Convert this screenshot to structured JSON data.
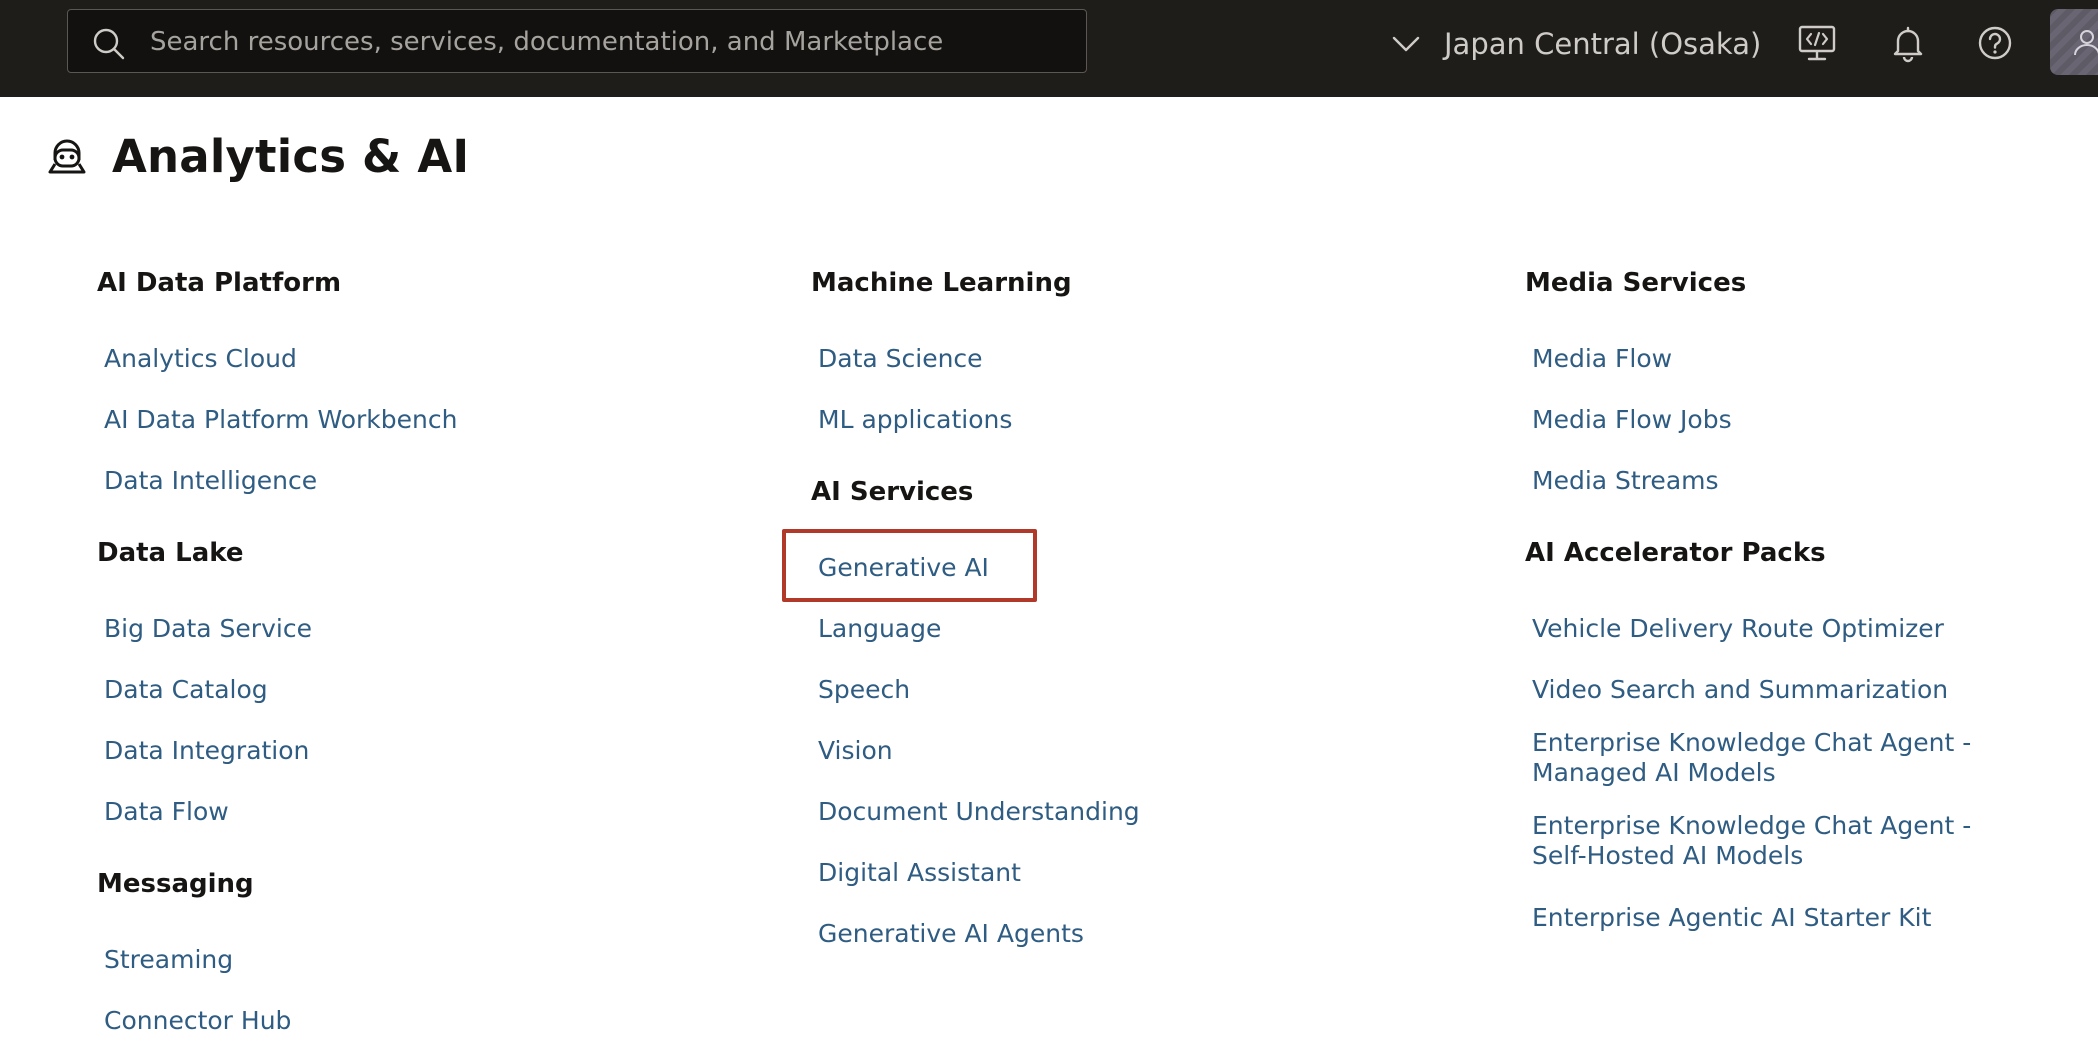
{
  "topbar": {
    "search_placeholder": "Search resources, services, documentation, and Marketplace",
    "region_label": "Japan Central (Osaka)"
  },
  "page": {
    "title": "Analytics & AI"
  },
  "columns": [
    {
      "groups": [
        {
          "heading": "AI Data Platform",
          "items": [
            "Analytics Cloud",
            "AI Data Platform Workbench",
            "Data Intelligence"
          ]
        },
        {
          "heading": "Data Lake",
          "items": [
            "Big Data Service",
            "Data Catalog",
            "Data Integration",
            "Data Flow"
          ]
        },
        {
          "heading": "Messaging",
          "items": [
            "Streaming",
            "Connector Hub"
          ]
        }
      ]
    },
    {
      "groups": [
        {
          "heading": "Machine Learning",
          "items": [
            "Data Science",
            "ML applications"
          ]
        },
        {
          "heading": "AI Services",
          "items": [
            "Generative AI",
            "Language",
            "Speech",
            "Vision",
            "Document Understanding",
            "Digital Assistant",
            "Generative AI Agents"
          ]
        }
      ]
    },
    {
      "groups": [
        {
          "heading": "Media Services",
          "items": [
            "Media Flow",
            "Media Flow Jobs",
            "Media Streams"
          ]
        },
        {
          "heading": "AI Accelerator Packs",
          "items": [
            "Vehicle Delivery Route Optimizer",
            "Video Search and Summarization",
            "Enterprise Knowledge Chat Agent - Managed AI Models",
            "Enterprise Knowledge Chat Agent - Self-Hosted AI Models",
            "Enterprise Agentic AI Starter Kit"
          ]
        }
      ]
    }
  ],
  "colors": {
    "topbar_bg": "#1f1d1a",
    "link": "#2f5c82",
    "highlight": "#b0392a"
  }
}
